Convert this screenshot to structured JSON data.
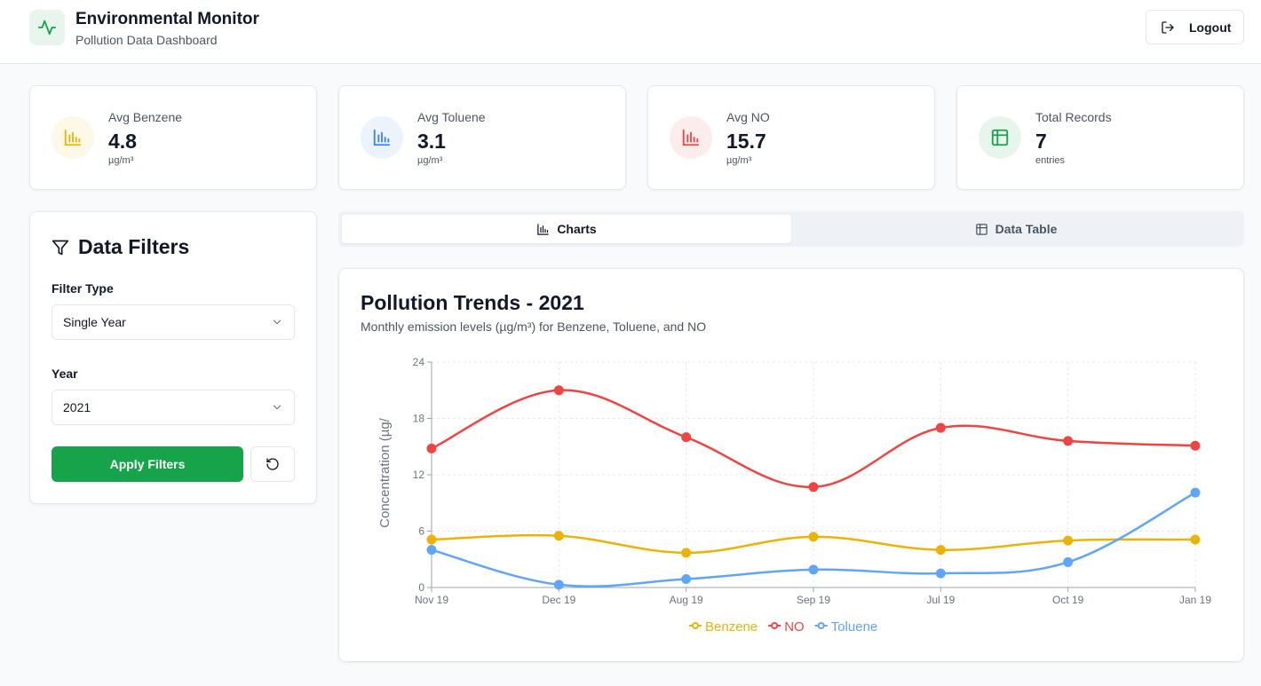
{
  "header": {
    "title": "Environmental Monitor",
    "subtitle": "Pollution Data Dashboard",
    "logout_label": "Logout"
  },
  "stats": [
    {
      "label": "Avg Benzene",
      "value": "4.8",
      "unit": "µg/m³",
      "icon": "bar-chart-icon",
      "color": "#eab308",
      "bg": "#fef9e7"
    },
    {
      "label": "Avg Toluene",
      "value": "3.1",
      "unit": "µg/m³",
      "icon": "bar-chart-icon",
      "color": "#3b82f6",
      "bg": "#ebf3fd"
    },
    {
      "label": "Avg NO",
      "value": "15.7",
      "unit": "µg/m³",
      "icon": "bar-chart-icon",
      "color": "#ef4444",
      "bg": "#fdecec"
    },
    {
      "label": "Total Records",
      "value": "7",
      "unit": "entries",
      "icon": "table-icon",
      "color": "#16a34a",
      "bg": "#e8f5ec"
    }
  ],
  "filters": {
    "title": "Data Filters",
    "filter_type_label": "Filter Type",
    "filter_type_value": "Single Year",
    "year_label": "Year",
    "year_value": "2021",
    "apply_label": "Apply Filters"
  },
  "tabs": [
    {
      "label": "Charts",
      "active": true
    },
    {
      "label": "Data Table",
      "active": false
    }
  ],
  "chart_data": {
    "type": "line",
    "title": "Pollution Trends - 2021",
    "subtitle": "Monthly emission levels (µg/m³) for Benzene, Toluene, and NO",
    "xlabel": "",
    "ylabel": "Concentration (µg/",
    "categories": [
      "Nov 19",
      "Dec 19",
      "Aug 19",
      "Sep 19",
      "Jul 19",
      "Oct 19",
      "Jan 19"
    ],
    "ylim": [
      0,
      24
    ],
    "yticks": [
      0,
      6,
      12,
      18,
      24
    ],
    "grid": true,
    "legend": "bottom",
    "series": [
      {
        "name": "Benzene",
        "color": "#eab308",
        "values": [
          5.1,
          5.5,
          3.7,
          5.4,
          4.0,
          5.0,
          5.1
        ]
      },
      {
        "name": "NO",
        "color": "#ef4444",
        "values": [
          14.8,
          21.0,
          16.0,
          10.7,
          17.0,
          15.6,
          15.1
        ]
      },
      {
        "name": "Toluene",
        "color": "#60a5fa",
        "values": [
          4.0,
          0.3,
          0.9,
          1.9,
          1.5,
          2.7,
          10.1
        ]
      }
    ]
  }
}
